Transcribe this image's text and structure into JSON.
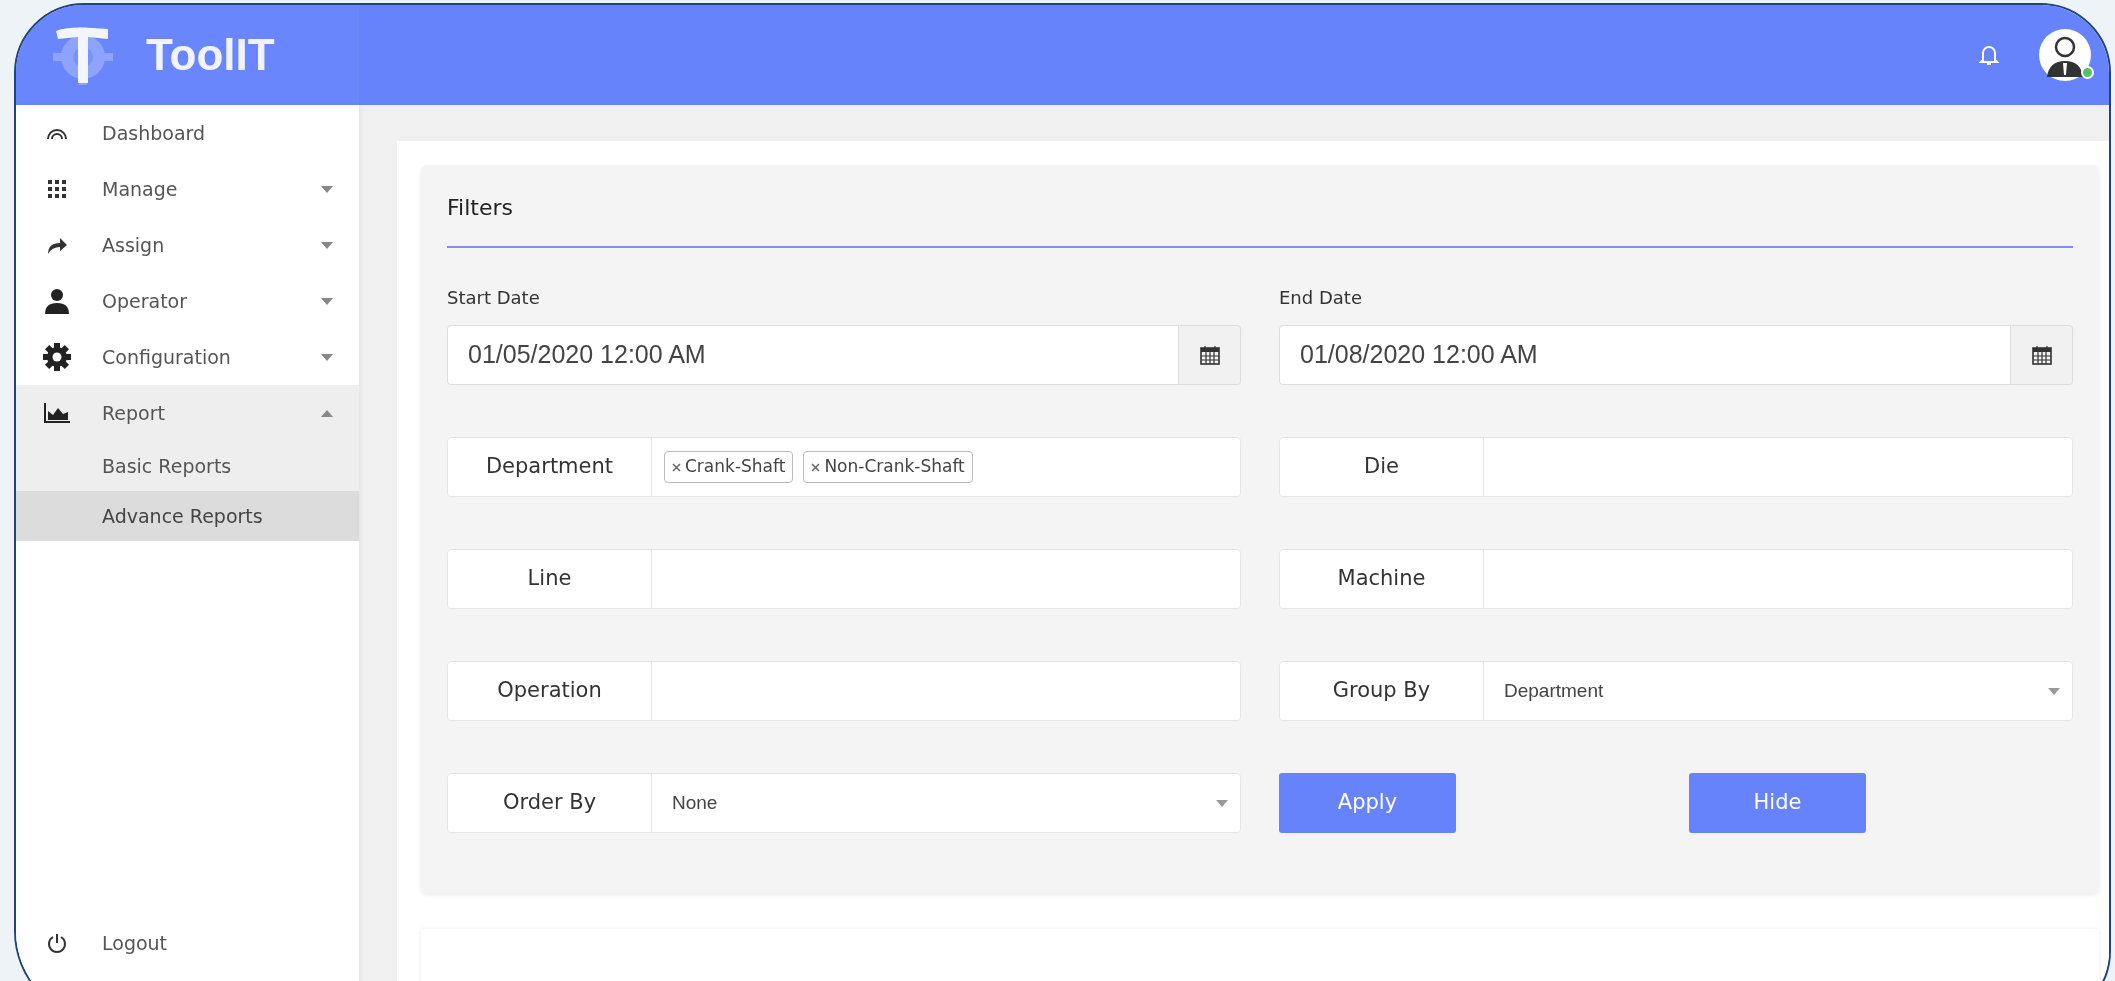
{
  "app": {
    "title": "ToolIT"
  },
  "user": {
    "online": true
  },
  "sidebar": {
    "items": [
      {
        "label": "Dashboard",
        "kind": "link"
      },
      {
        "label": "Manage",
        "kind": "menu",
        "expanded": false
      },
      {
        "label": "Assign",
        "kind": "menu",
        "expanded": false
      },
      {
        "label": "Operator",
        "kind": "menu",
        "expanded": false
      },
      {
        "label": "Configuration",
        "kind": "menu",
        "expanded": false
      },
      {
        "label": "Report",
        "kind": "menu",
        "expanded": true,
        "children": [
          {
            "label": "Basic Reports",
            "selected": false
          },
          {
            "label": "Advance Reports",
            "selected": true
          }
        ]
      }
    ],
    "logout": "Logout"
  },
  "filters": {
    "title": "Filters",
    "dates": [
      {
        "label": "Start Date",
        "value": "01/05/2020 12:00 AM"
      },
      {
        "label": "End Date",
        "value": "01/08/2020 12:00 AM"
      }
    ],
    "fields": [
      {
        "label": "Department",
        "kind": "tags",
        "tags": [
          "Crank-Shaft",
          "Non-Crank-Shaft"
        ]
      },
      {
        "label": "Die",
        "kind": "text"
      },
      {
        "label": "Line",
        "kind": "text"
      },
      {
        "label": "Machine",
        "kind": "text"
      },
      {
        "label": "Operation",
        "kind": "text"
      },
      {
        "label": "Group By",
        "kind": "select",
        "value": "Department"
      },
      {
        "label": "Order By",
        "kind": "select",
        "value": "None"
      }
    ],
    "buttons": [
      "Apply",
      "Hide"
    ]
  }
}
